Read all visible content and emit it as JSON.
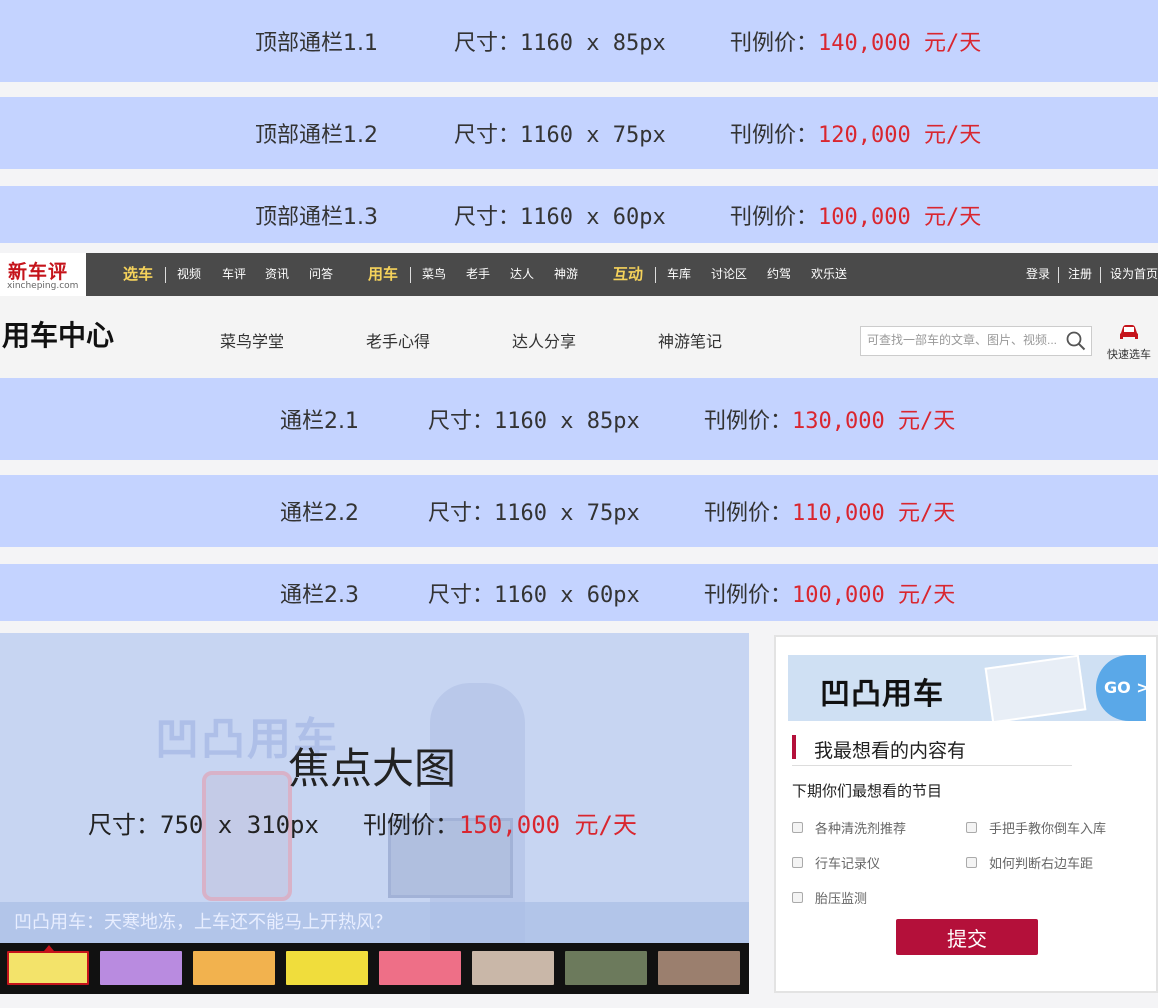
{
  "top_banners": [
    {
      "name": "顶部通栏1.1",
      "size": "尺寸：1160 x 85px",
      "price_label": "刊例价：",
      "price_value": "140,000 元/天"
    },
    {
      "name": "顶部通栏1.2",
      "size": "尺寸：1160 x 75px",
      "price_label": "刊例价：",
      "price_value": "120,000 元/天"
    },
    {
      "name": "顶部通栏1.3",
      "size": "尺寸：1160 x 60px",
      "price_label": "刊例价：",
      "price_value": "100,000 元/天"
    }
  ],
  "topnav": {
    "logo": "新车评",
    "logo_sub": "xincheping.com",
    "groups": [
      {
        "major": "选车",
        "items": [
          "视频",
          "车评",
          "资讯",
          "问答"
        ]
      },
      {
        "major": "用车",
        "items": [
          "菜鸟",
          "老手",
          "达人",
          "神游"
        ]
      },
      {
        "major": "互动",
        "items": [
          "车库",
          "讨论区",
          "约驾",
          "欢乐送"
        ]
      }
    ],
    "right": [
      "登录",
      "注册",
      "设为首页"
    ]
  },
  "subheader": {
    "title": "用车中心",
    "tabs": [
      "菜鸟学堂",
      "老手心得",
      "达人分享",
      "神游笔记"
    ],
    "search_placeholder": "可查找一部车的文章、图片、视频...",
    "quick_select": "快速选车"
  },
  "mid_banners": [
    {
      "name": "通栏2.1",
      "size": "尺寸：1160 x 85px",
      "price_label": "刊例价：",
      "price_value": "130,000 元/天"
    },
    {
      "name": "通栏2.2",
      "size": "尺寸：1160 x 75px",
      "price_label": "刊例价：",
      "price_value": "110,000 元/天"
    },
    {
      "name": "通栏2.3",
      "size": "尺寸：1160 x 60px",
      "price_label": "刊例价：",
      "price_value": "100,000 元/天"
    }
  ],
  "focus": {
    "watermark": "凹凸用车",
    "title": "焦点大图",
    "size": "尺寸：750 x 310px",
    "price_label": "刊例价：",
    "price_value": "150,000 元/天",
    "caption": "凹凸用车：天寒地冻，上车还不能马上开热风？",
    "thumb_colors": [
      "#f3e36a",
      "#b98be0",
      "#f2b24e",
      "#f0dd3c",
      "#ee6f87",
      "#c9b7a8",
      "#6c7a5c",
      "#9b7f6e"
    ]
  },
  "survey": {
    "ad_text": "凹凸用车",
    "ad_go": "GO >",
    "title": "我最想看的内容有",
    "subtitle": "下期你们最想看的节目",
    "options": [
      "各种清洗剂推荐",
      "手把手教你倒车入库",
      "行车记录仪",
      "如何判断右边车距",
      "胎压监测"
    ],
    "submit": "提交"
  }
}
